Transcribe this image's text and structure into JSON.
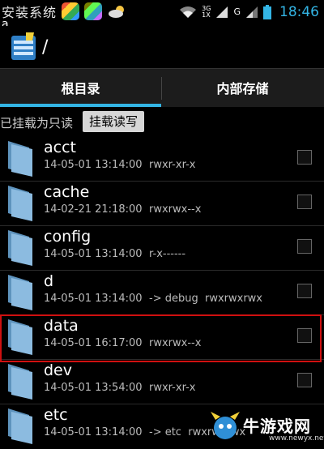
{
  "statusbar": {
    "notif_text": "安装系统",
    "notif_sub": "a...........",
    "network_label_top": "3G",
    "network_label_bottom": "1X",
    "signal_label": "G",
    "clock": "18:46"
  },
  "titlebar": {
    "path": "/"
  },
  "tabs": [
    {
      "label": "根目录"
    },
    {
      "label": "内部存储"
    }
  ],
  "mount": {
    "status": "已挂载为只读",
    "button": "挂载读写"
  },
  "files": [
    {
      "name": "acct",
      "date": "14-05-01 13:14:00",
      "perm": "rwxr-xr-x"
    },
    {
      "name": "cache",
      "date": "14-02-21 21:18:00",
      "perm": "rwxrwx--x"
    },
    {
      "name": "config",
      "date": "14-05-01 13:14:00",
      "perm": "r-x------"
    },
    {
      "name": "d",
      "date": "14-05-01 13:14:00",
      "perm": "-> debug  rwxrwxrwx"
    },
    {
      "name": "data",
      "date": "14-05-01 16:17:00",
      "perm": "rwxrwx--x"
    },
    {
      "name": "dev",
      "date": "14-05-01 13:54:00",
      "perm": "rwxr-xr-x"
    },
    {
      "name": "etc",
      "date": "14-05-01 13:14:00",
      "perm": "-> etc  rwxrwxrwx"
    }
  ],
  "watermark": {
    "text": "牛游戏网",
    "url": "www.newyx.net"
  },
  "colors": {
    "accent": "#33b5e5",
    "highlight": "#d01010",
    "folder": "#6fa3c8"
  }
}
